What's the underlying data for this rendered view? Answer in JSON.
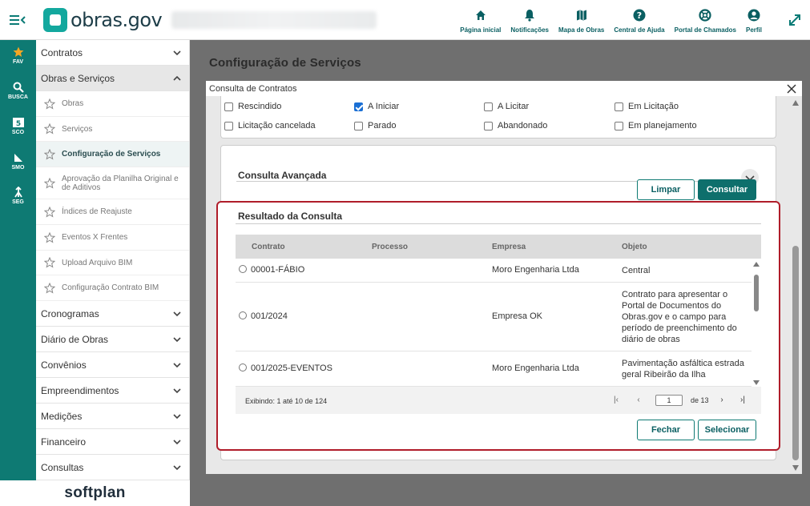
{
  "header": {
    "logo_text": "obras.gov",
    "nav": [
      {
        "label": "Página inicial",
        "icon": "home-icon"
      },
      {
        "label": "Notificações",
        "icon": "bell-icon"
      },
      {
        "label": "Mapa de Obras",
        "icon": "map-icon"
      },
      {
        "label": "Central de Ajuda",
        "icon": "help-icon"
      },
      {
        "label": "Portal de Chamados",
        "icon": "lifebuoy-icon"
      },
      {
        "label": "Perfil",
        "icon": "user-icon"
      }
    ]
  },
  "rail": [
    {
      "label": "FAV",
      "icon": "star-icon"
    },
    {
      "label": "BUSCA",
      "icon": "search-icon"
    },
    {
      "label": "SCO",
      "icon": "sco-icon"
    },
    {
      "label": "SMO",
      "icon": "smo-icon"
    },
    {
      "label": "SEG",
      "icon": "seg-icon"
    }
  ],
  "sidebar": {
    "sections_top": [
      {
        "label": "Contratos",
        "open": false
      },
      {
        "label": "Obras e Serviços",
        "open": true
      }
    ],
    "sub_items": [
      {
        "label": "Obras"
      },
      {
        "label": "Serviços"
      },
      {
        "label": "Configuração de Serviços",
        "active": true
      },
      {
        "label": "Aprovação da Planilha Original e de Aditivos"
      },
      {
        "label": "Índices de Reajuste"
      },
      {
        "label": "Eventos X Frentes"
      },
      {
        "label": "Upload Arquivo BIM"
      },
      {
        "label": "Configuração Contrato BIM"
      }
    ],
    "sections_bottom": [
      {
        "label": "Cronogramas"
      },
      {
        "label": "Diário de Obras"
      },
      {
        "label": "Convênios"
      },
      {
        "label": "Empreendimentos"
      },
      {
        "label": "Medições"
      },
      {
        "label": "Financeiro"
      },
      {
        "label": "Consultas"
      }
    ],
    "footer_logo": "softplan"
  },
  "page": {
    "title": "Configuração de Serviços"
  },
  "modal": {
    "title": "Consulta de Contratos",
    "status_checkboxes": [
      {
        "label": "Rescindido",
        "checked": false
      },
      {
        "label": "A Iniciar",
        "checked": true
      },
      {
        "label": "A Licitar",
        "checked": false
      },
      {
        "label": "Em Licitação",
        "checked": false
      },
      {
        "label": "Licitação cancelada",
        "checked": false
      },
      {
        "label": "Parado",
        "checked": false
      },
      {
        "label": "Abandonado",
        "checked": false
      },
      {
        "label": "Em planejamento",
        "checked": false
      }
    ],
    "advanced_title": "Consulta Avançada",
    "clear_label": "Limpar",
    "search_label": "Consultar",
    "results": {
      "title": "Resultado da Consulta",
      "columns": [
        "Contrato",
        "Processo",
        "Empresa",
        "Objeto"
      ],
      "rows": [
        {
          "contrato": "00001-FÁBIO",
          "processo": "",
          "empresa": "Moro Engenharia Ltda",
          "objeto": [
            "Central"
          ]
        },
        {
          "contrato": "001/2024",
          "processo": "",
          "empresa": "Empresa OK",
          "objeto": [
            "Contrato para apresentar o",
            "Portal de Documentos do",
            "Obras.gov e o campo para",
            "período de preenchimento do",
            "diário de obras"
          ]
        },
        {
          "contrato": "001/2025-EVENTOS",
          "processo": "",
          "empresa": "Moro Engenharia Ltda",
          "objeto": [
            "Pavimentação asfáltica estrada",
            "geral Ribeirão da Ilha"
          ]
        }
      ],
      "showing": "Exibindo: 1 até 10 de 124",
      "current_page": "1",
      "of_pages": "de 13"
    },
    "close_label": "Fechar",
    "select_label": "Selecionar"
  }
}
